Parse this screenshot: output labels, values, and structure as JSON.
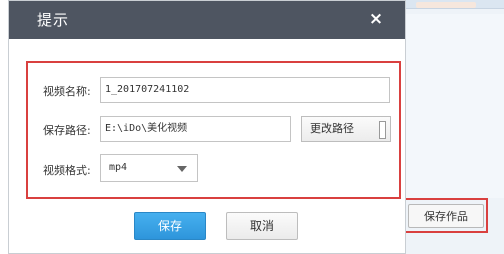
{
  "dialog": {
    "title": "提示",
    "close_icon": "×",
    "fields": {
      "name_label": "视频名称:",
      "name_value": "1_201707241102",
      "path_label": "保存路径:",
      "path_value": "E:\\iDo\\美化视频",
      "change_path_label": "更改路径",
      "format_label": "视频格式:",
      "format_value": "mp4"
    },
    "buttons": {
      "save": "保存",
      "cancel": "取消"
    }
  },
  "background": {
    "save_work_button": "保存作品"
  },
  "colors": {
    "titlebar": "#4e5561",
    "highlight_red": "#d9403f",
    "primary_blue": "#2e95db"
  }
}
